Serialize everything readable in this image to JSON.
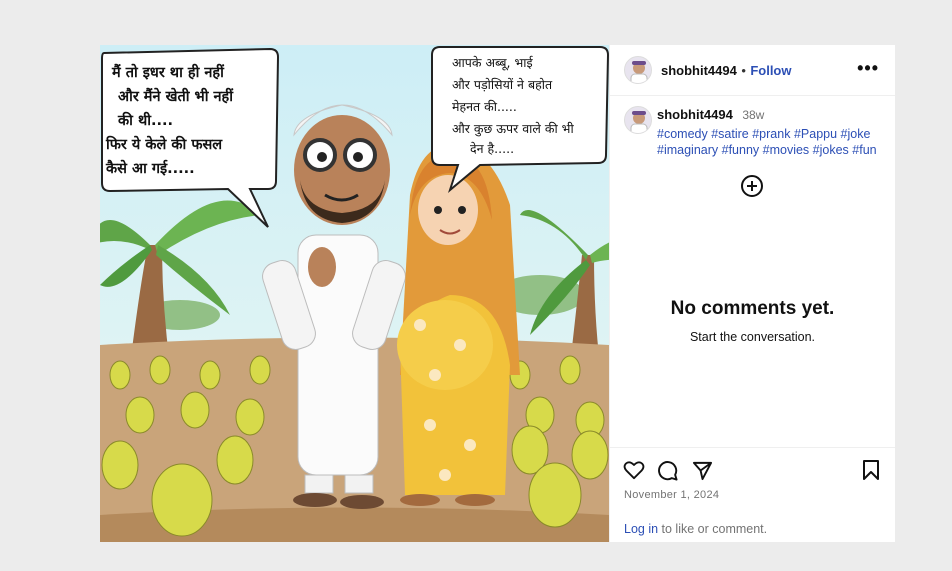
{
  "post": {
    "speech_left": [
      "मैं तो इधर था ही नहीं",
      "और मैंने खेती भी नहीं",
      "की थी....",
      "फिर ये केले की फसल",
      "कैसे आ गई....."
    ],
    "speech_right": [
      "आपके अब्बू, भाई",
      "और पड़ोसियों ने बहोत",
      "मेहनत की.....",
      "और कुछ ऊपर वाले की भी",
      "देन है....."
    ]
  },
  "header": {
    "username": "shobhit4494",
    "separator": "•",
    "follow_label": "Follow",
    "more_label": "•••"
  },
  "caption": {
    "username": "shobhit4494",
    "time": "38w",
    "hashtags": [
      "#comedy",
      "#satire",
      "#prank",
      "#Pappu",
      "#joke",
      "#imaginary",
      "#funny",
      "#movies",
      "#jokes",
      "#fun"
    ]
  },
  "comments": {
    "empty_title": "No comments yet.",
    "empty_subtitle": "Start the conversation."
  },
  "actions": {
    "date": "November 1, 2024",
    "login_link": "Log in",
    "login_rest": " to like or comment.",
    "icons": [
      "heart-icon",
      "comment-icon",
      "share-icon",
      "bookmark-icon"
    ]
  },
  "colors": {
    "link": "#2c4fb5",
    "muted": "#737373",
    "sky": "#bfe6f2",
    "soil": "#c9a47a"
  }
}
